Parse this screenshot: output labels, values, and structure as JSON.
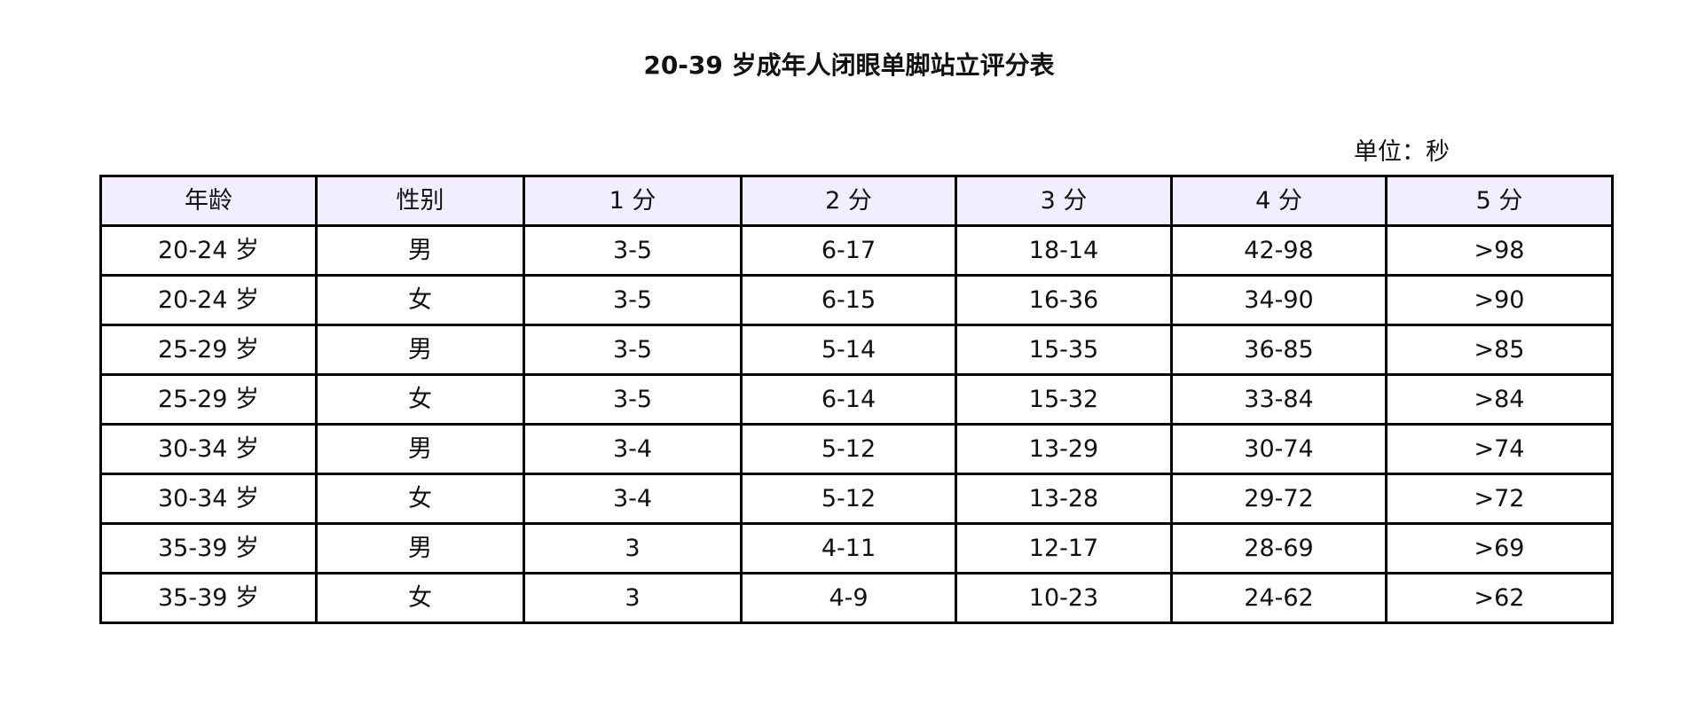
{
  "title": "20-39 岁成年人闭眼单脚站立评分表",
  "unit": "单位：秒",
  "colors": {
    "header_bg": "#f3eeff",
    "border": "#000000",
    "text": "#111111"
  },
  "table": {
    "headers": [
      "年龄",
      "性别",
      "1 分",
      "2 分",
      "3 分",
      "4 分",
      "5 分"
    ],
    "rows": [
      [
        "20-24 岁",
        "男",
        "3-5",
        "6-17",
        "18-14",
        "42-98",
        ">98"
      ],
      [
        "20-24 岁",
        "女",
        "3-5",
        "6-15",
        "16-36",
        "34-90",
        ">90"
      ],
      [
        "25-29 岁",
        "男",
        "3-5",
        "5-14",
        "15-35",
        "36-85",
        ">85"
      ],
      [
        "25-29 岁",
        "女",
        "3-5",
        "6-14",
        "15-32",
        "33-84",
        ">84"
      ],
      [
        "30-34 岁",
        "男",
        "3-4",
        "5-12",
        "13-29",
        "30-74",
        ">74"
      ],
      [
        "30-34 岁",
        "女",
        "3-4",
        "5-12",
        "13-28",
        "29-72",
        ">72"
      ],
      [
        "35-39 岁",
        "男",
        "3",
        "4-11",
        "12-17",
        "28-69",
        ">69"
      ],
      [
        "35-39 岁",
        "女",
        "3",
        "4-9",
        "10-23",
        "24-62",
        ">62"
      ]
    ]
  }
}
